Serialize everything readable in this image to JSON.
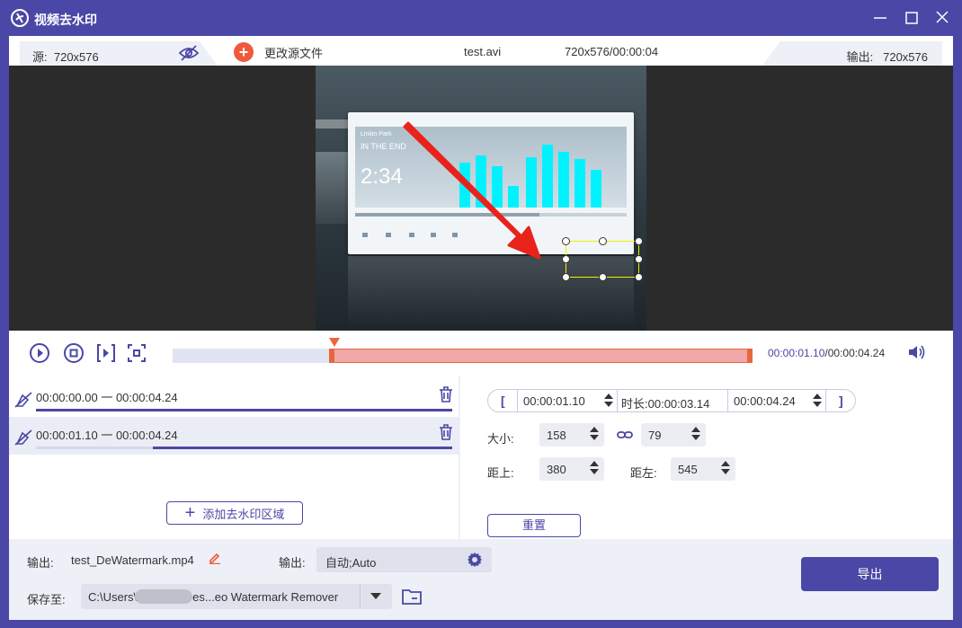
{
  "window": {
    "title": "视频去水印"
  },
  "infobar": {
    "source_label": "源:",
    "source_res": "720x576",
    "change_source_label": "更改源文件",
    "file_name": "test.avi",
    "file_meta": "720x576/00:00:04",
    "output_label": "输出:",
    "output_res": "720x576"
  },
  "video_frame": {
    "artist": "Linkin Park",
    "song": "IN THE END",
    "time": "2:34",
    "visualizer_color": "#00f2ff"
  },
  "timeline": {
    "current_time": "00:00:01.10",
    "total_time": "00:00:04.24",
    "segment_start_fraction": 0.27,
    "segment_end_fraction": 1.0
  },
  "regions": [
    {
      "start": "00:00:00.00",
      "sep": "一",
      "end": "00:00:04.24",
      "fill_start": 0.0,
      "fill_end": 1.0
    },
    {
      "start": "00:00:01.10",
      "sep": "一",
      "end": "00:00:04.24",
      "fill_start": 0.28,
      "fill_end": 1.0
    }
  ],
  "add_region_label": "添加去水印区域",
  "settings": {
    "range_open": "[",
    "range_close": "]",
    "start_time": "00:00:01.10",
    "duration_label": "时长:",
    "duration": "00:00:03.14",
    "end_time": "00:00:04.24",
    "size_label": "大小:",
    "width": "158",
    "height": "79",
    "top_label": "距上:",
    "top_value": "380",
    "left_label": "距左:",
    "left_value": "545",
    "reset_label": "重置"
  },
  "bottom": {
    "output_name_label": "输出:",
    "output_name": "test_DeWatermark.mp4",
    "output_format_label": "输出:",
    "output_format": "自动;Auto",
    "save_to_label": "保存至:",
    "save_path_prefix": "C:\\Users\\",
    "save_path_suffix": "es...eo Watermark Remover",
    "export_label": "导出"
  },
  "colors": {
    "brand": "#4b47a6",
    "accent": "#f05a3c",
    "segment": "#f0a8a8",
    "selection": "#f0f000",
    "arrow": "#e8231c"
  }
}
